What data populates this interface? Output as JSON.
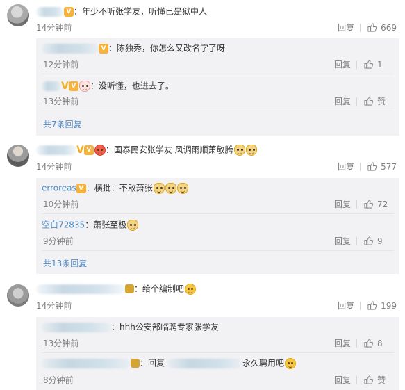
{
  "comments": [
    {
      "text": "：年少不听张学友，听懂已是狱中人",
      "time": "14分钟前",
      "reply": "回复",
      "likes": "669",
      "sub_replies": [
        {
          "text": "：陈独秀，你怎么又改名字了呀",
          "time": "12分钟前",
          "reply": "回复",
          "likes": "1"
        },
        {
          "text": "：没听懂，也进去了。",
          "time": "13分钟前",
          "reply": "回复",
          "likes": "赞"
        }
      ],
      "more": "共7条回复"
    },
    {
      "text": "：国泰民安张学友 风调雨顺萧敬腾",
      "time": "14分钟前",
      "reply": "回复",
      "likes": "577",
      "sub_replies": [
        {
          "user": "erroreas",
          "text": "：横批：不敢萧张",
          "time": "10分钟前",
          "reply": "回复",
          "likes": "72"
        },
        {
          "user": "空白72835",
          "text": "：萧张至极",
          "time": "9分钟前",
          "reply": "回复",
          "likes": "9"
        }
      ],
      "more": "共13条回复"
    },
    {
      "text": "：给个编制吧",
      "time": "14分钟前",
      "reply": "回复",
      "likes": "199",
      "sub_replies": [
        {
          "text": "：hhh公安部临聘专家张学友",
          "time": "13分钟前",
          "reply": "回复",
          "likes": "8"
        },
        {
          "text_a": "：回复",
          "text_b": "永久聘用吧",
          "time": "8分钟前",
          "reply": "回复",
          "likes": "赞"
        }
      ]
    }
  ],
  "icons": {
    "thumb": "thumbs-up-icon",
    "vip": "vip-badge-icon",
    "verified": "verified-v-icon",
    "emoji": "smile-emoji-icon",
    "cat": "cat-emoji-icon"
  },
  "colors": {
    "link": "#4e8ac2",
    "username_vip": "#eb7350",
    "time": "#808080",
    "sub_bg": "#f2f2f5"
  }
}
